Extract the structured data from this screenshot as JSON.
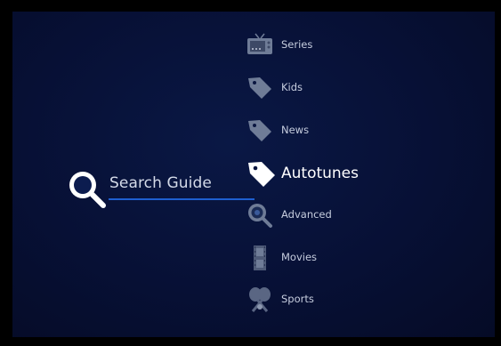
{
  "search": {
    "label": "Search Guide",
    "icon": "magnifier-icon"
  },
  "menu": {
    "items": [
      {
        "id": "series",
        "label": "Series",
        "icon": "tv-icon"
      },
      {
        "id": "kids",
        "label": "Kids",
        "icon": "tag-icon"
      },
      {
        "id": "news",
        "label": "News",
        "icon": "tag-icon"
      },
      {
        "id": "autotunes",
        "label": "Autotunes",
        "icon": "tag-icon",
        "selected": true
      },
      {
        "id": "advanced",
        "label": "Advanced",
        "icon": "magnifier-icon"
      },
      {
        "id": "movies",
        "label": "Movies",
        "icon": "film-icon"
      },
      {
        "id": "sports",
        "label": "Sports",
        "icon": "sports-icon"
      }
    ]
  },
  "colors": {
    "background": "#071035",
    "accent": "#1e5fd0",
    "text": "#c6cdde",
    "selected_text": "#ffffff",
    "icon_dim": "#6f7c97",
    "icon_bright": "#ffffff"
  }
}
